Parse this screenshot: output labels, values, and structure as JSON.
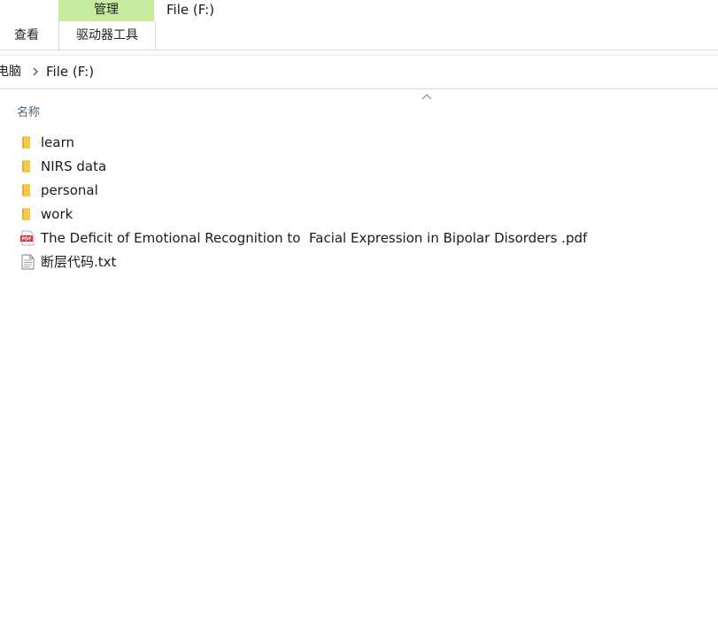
{
  "ribbon": {
    "context_group_label": "管理",
    "window_title": "File (F:)",
    "tabs": [
      {
        "label": "查看"
      },
      {
        "label": "驱动器工具"
      }
    ]
  },
  "address": {
    "crumbs": [
      "电脑",
      "File (F:)"
    ]
  },
  "columns": {
    "name_header": "名称"
  },
  "files": [
    {
      "name": "learn",
      "icon": "folder-icon"
    },
    {
      "name": "NIRS data",
      "icon": "folder-icon"
    },
    {
      "name": "personal",
      "icon": "folder-icon"
    },
    {
      "name": "work",
      "icon": "folder-icon"
    },
    {
      "name": "The Deficit of Emotional Recognition to  Facial Expression in Bipolar Disorders .pdf",
      "icon": "pdf-icon"
    },
    {
      "name": "断层代码.txt",
      "icon": "text-file-icon"
    }
  ],
  "colors": {
    "context_group": "#c6eb9e",
    "folder": "#f6c94a",
    "pdf": "#d32f2f",
    "header_text": "#4c607a"
  }
}
